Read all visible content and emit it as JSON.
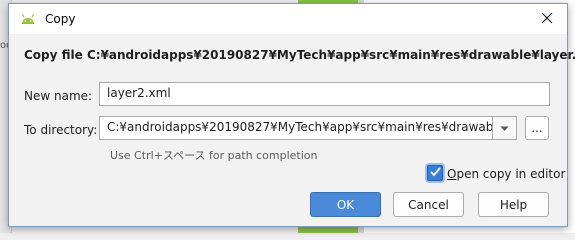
{
  "background": {
    "left_fragment": "oor",
    "colors": {
      "green": "#8bc34a",
      "right": "#ffffff"
    }
  },
  "dialog": {
    "title": "Copy",
    "title_icon": "android-icon",
    "close_icon": "close-icon",
    "header": "Copy file C:¥androidapps¥20190827¥MyTech¥app¥src¥main¥res¥drawable¥layer.xml",
    "new_name": {
      "label": "New name:",
      "value": "layer2.xml"
    },
    "to_directory": {
      "label": "To directory:",
      "value": "C:¥androidapps¥20190827¥MyTech¥app¥src¥main¥res¥drawable",
      "browse_label": "...",
      "dropdown_icon": "chevron-down-icon"
    },
    "hint": "Use Ctrl+スペース for path completion",
    "open_copy": {
      "mnemonic": "O",
      "rest": "pen copy in editor",
      "checked": true
    },
    "buttons": {
      "ok": "OK",
      "cancel": "Cancel",
      "help": "Help"
    },
    "colors": {
      "primary": "#4a8ad8",
      "checkbox": "#3a7dd6",
      "android": "#97c03d"
    }
  }
}
